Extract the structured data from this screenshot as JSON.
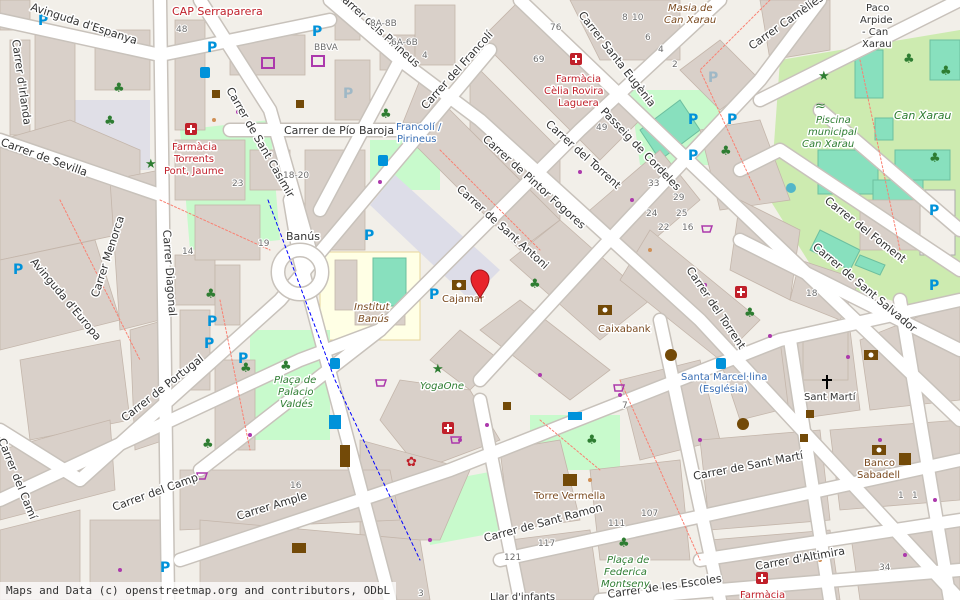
{
  "map": {
    "streets": [
      {
        "id": "avinguda-espanya",
        "text": "Avinguda d'Espanya"
      },
      {
        "id": "carrer-irlanda",
        "text": "Carrer d'Irlanda"
      },
      {
        "id": "carrer-sevilla",
        "text": "Carrer de Sevilla"
      },
      {
        "id": "carrer-menorca",
        "text": "Carrer Menorca"
      },
      {
        "id": "avinguda-europa",
        "text": "Avinguda d'Europa"
      },
      {
        "id": "carrer-diagonal",
        "text": "Carrer Diagonal"
      },
      {
        "id": "carrer-sant-casimir",
        "text": "Carrer de Sant Casimir"
      },
      {
        "id": "carrer-pio-baroja",
        "text": "Carrer de Pío Baroja"
      },
      {
        "id": "carrer-francoli",
        "text": "Carrer del Francolí"
      },
      {
        "id": "carrer-pirineus",
        "text": "Carrer dels Pirineus"
      },
      {
        "id": "carrer-pintor-fogores",
        "text": "Carrer de Pintor Fogores"
      },
      {
        "id": "carrer-sant-antoni",
        "text": "Carrer de Sant Antoni"
      },
      {
        "id": "carrer-torrent-1",
        "text": "Carrer del Torrent"
      },
      {
        "id": "carrer-torrent-2",
        "text": "Carrer del Torrent"
      },
      {
        "id": "carrer-santa-eugenia",
        "text": "Carrer Santa Eugènia"
      },
      {
        "id": "passeig-cordeles",
        "text": "Passeig de Cordeles"
      },
      {
        "id": "carrer-cameles",
        "text": "Carrer Camèlies"
      },
      {
        "id": "carrer-foment",
        "text": "Carrer del Foment"
      },
      {
        "id": "carrer-sant-salvador",
        "text": "Carrer de Sant Salvador"
      },
      {
        "id": "carrer-portugal",
        "text": "Carrer de Portugal"
      },
      {
        "id": "carrer-camp",
        "text": "Carrer del Camp"
      },
      {
        "id": "carrer-ample",
        "text": "Carrer Ample"
      },
      {
        "id": "carrer-sant-marti",
        "text": "Carrer de Sant Martí"
      },
      {
        "id": "carrer-sant-ramon",
        "text": "Carrer de Sant Ramon"
      },
      {
        "id": "carrer-altimira",
        "text": "Carrer d'Altimira"
      },
      {
        "id": "carrer-escoles",
        "text": "Carrer de les Escoles"
      },
      {
        "id": "carrer-cami",
        "text": "Carrer del Camí"
      }
    ],
    "pois": [
      {
        "id": "cap-serraparera",
        "text": "CAP Serraparera"
      },
      {
        "id": "bbva",
        "text": "BBVA"
      },
      {
        "id": "farmacia-torrents-1",
        "text": "Farmàcia"
      },
      {
        "id": "farmacia-torrents-2",
        "text": "Torrents"
      },
      {
        "id": "farmacia-torrents-3",
        "text": "Pont, Jaume"
      },
      {
        "id": "farmacia-celia-1",
        "text": "Farmàcia"
      },
      {
        "id": "farmacia-celia-2",
        "text": "Cèlia Rovira"
      },
      {
        "id": "farmacia-celia-3",
        "text": "Laguera"
      },
      {
        "id": "francoli-pirineus-1",
        "text": "Francolí /"
      },
      {
        "id": "francoli-pirineus-2",
        "text": "Pirineus"
      },
      {
        "id": "masia-1",
        "text": "Masia de"
      },
      {
        "id": "masia-2",
        "text": "Can Xarau"
      },
      {
        "id": "paco-arpide-1",
        "text": "Paco"
      },
      {
        "id": "paco-arpide-2",
        "text": "Arpide"
      },
      {
        "id": "paco-arpide-3",
        "text": "- Can"
      },
      {
        "id": "paco-arpide-4",
        "text": "Xarau"
      },
      {
        "id": "can-xarau",
        "text": "Can Xarau"
      },
      {
        "id": "piscina-1",
        "text": "Piscina"
      },
      {
        "id": "piscina-2",
        "text": "municipal"
      },
      {
        "id": "piscina-3",
        "text": "Can Xarau"
      },
      {
        "id": "banus",
        "text": "Banús"
      },
      {
        "id": "institut-banus-1",
        "text": "Institut"
      },
      {
        "id": "institut-banus-2",
        "text": "Banús"
      },
      {
        "id": "cajamar",
        "text": "Cajamar"
      },
      {
        "id": "caixabank",
        "text": "Caixabank"
      },
      {
        "id": "yogaone",
        "text": "YogaOne"
      },
      {
        "id": "placa-palacio-1",
        "text": "Plaça de"
      },
      {
        "id": "placa-palacio-2",
        "text": "Palacio"
      },
      {
        "id": "placa-palacio-3",
        "text": "Valdés"
      },
      {
        "id": "santa-marcel-1",
        "text": "Santa Marcel·lina"
      },
      {
        "id": "santa-marcel-2",
        "text": "(Església)"
      },
      {
        "id": "sant-marti",
        "text": "Sant Martí"
      },
      {
        "id": "banco-sabadell-1",
        "text": "Banco"
      },
      {
        "id": "banco-sabadell-2",
        "text": "Sabadell"
      },
      {
        "id": "torre-vermella",
        "text": "Torre Vermella"
      },
      {
        "id": "placa-federica-1",
        "text": "Plaça de"
      },
      {
        "id": "placa-federica-2",
        "text": "Federica"
      },
      {
        "id": "placa-federica-3",
        "text": "Montseny"
      },
      {
        "id": "farmacia-bottom",
        "text": "Farmàcia"
      },
      {
        "id": "llar-infants",
        "text": "Llar d'infants"
      }
    ],
    "house_numbers": [
      "48",
      "8A-8B",
      "6A-6B",
      "4",
      "76",
      "8",
      "10",
      "6",
      "4",
      "2",
      "69",
      "49",
      "18-20",
      "23",
      "19",
      "14",
      "33",
      "29",
      "25",
      "24",
      "22",
      "16",
      "18",
      "16",
      "7",
      "111",
      "107",
      "121",
      "117",
      "3",
      "34",
      "1",
      "1"
    ],
    "marker": {
      "color": "#e8242b",
      "label": "selected-location"
    },
    "colors": {
      "background": "#f2efe9",
      "building": "#d9d0c9",
      "park": "#c8facc",
      "pitch": "#88e0be",
      "school": "#ffffe5",
      "pedestrian": "#dddde8",
      "road": "#ffffff",
      "road_casing": "#c8c2bb",
      "footway": "#fa8072",
      "cycleway": "#0000ff",
      "boundary": "#e8a0a0"
    }
  },
  "attribution": "Maps and Data (c) openstreetmap.org and contributors, ODbL"
}
